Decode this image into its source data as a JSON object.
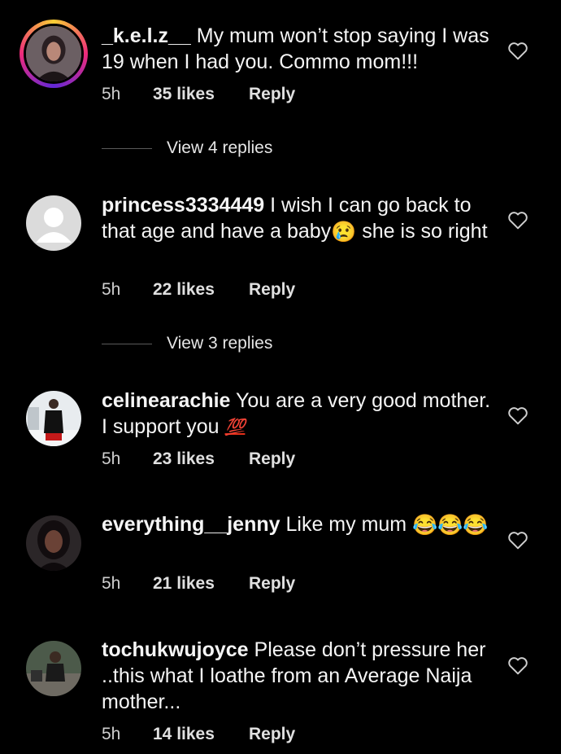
{
  "comments": [
    {
      "username": "_k.e.l.z__",
      "text": "My mum won’t stop saying I was 19 when I had you. Commo mom!!!",
      "time": "5h",
      "likes": "35 likes",
      "reply": "Reply",
      "view_replies": "View 4 replies"
    },
    {
      "username": "princess3334449",
      "text_before": "I wish I can go back to that age and have a baby",
      "text_after": " she is so right",
      "emoji": "😢",
      "time": "5h",
      "likes": "22 likes",
      "reply": "Reply",
      "view_replies": "View 3 replies"
    },
    {
      "username": "celinearachie",
      "text": "You are a very good mother. I support you ",
      "emoji": "💯",
      "time": "5h",
      "likes": "23 likes",
      "reply": "Reply"
    },
    {
      "username": "everything__jenny",
      "text": "Like my mum ",
      "emoji": "😂😂😂",
      "time": "5h",
      "likes": "21 likes",
      "reply": "Reply"
    },
    {
      "username": "tochukwujoyce",
      "text": "Please don’t pressure her ..this what I loathe from an Average Naija mother...",
      "time": "5h",
      "likes": "14 likes",
      "reply": "Reply"
    }
  ],
  "icons": {
    "like": "heart-outline-icon",
    "default_avatar": "default-avatar-icon"
  }
}
